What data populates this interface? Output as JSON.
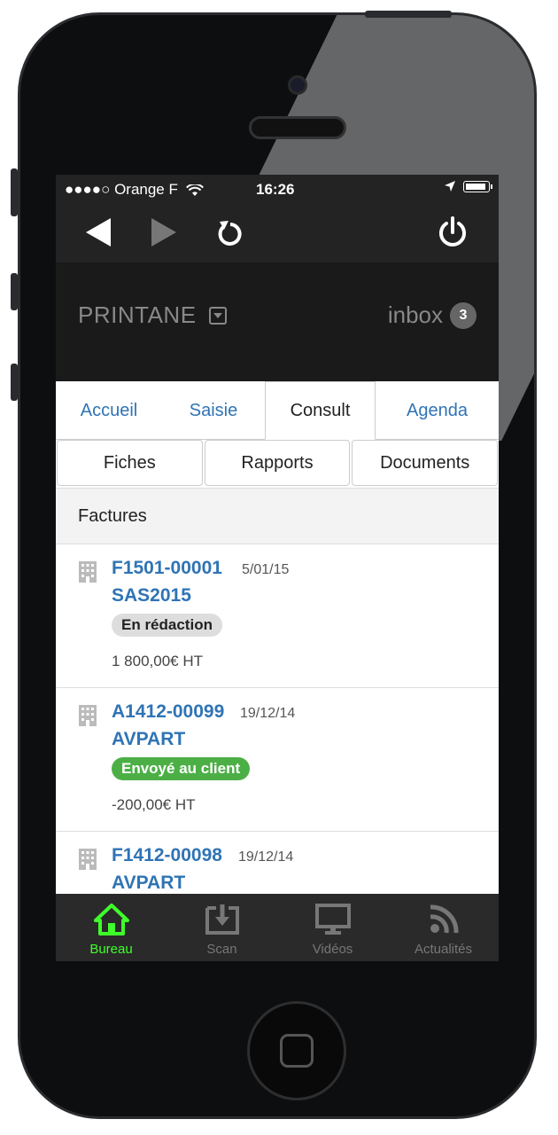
{
  "status_bar": {
    "carrier": "●●●●○ Orange F",
    "time": "16:26"
  },
  "header": {
    "brand": "PRINTANE",
    "inbox_label": "inbox",
    "inbox_count": "3"
  },
  "tabs": [
    {
      "label": "Accueil",
      "active": false
    },
    {
      "label": "Saisie",
      "active": false
    },
    {
      "label": "Consult",
      "active": true
    },
    {
      "label": "Agenda",
      "active": false
    }
  ],
  "segments": [
    {
      "label": "Fiches"
    },
    {
      "label": "Rapports"
    },
    {
      "label": "Documents"
    }
  ],
  "section_title": "Factures",
  "invoices": [
    {
      "ref": "F1501-00001",
      "date": "5/01/15",
      "client": "SAS2015",
      "status": "En rédaction",
      "status_color": "#dddddd",
      "amount": "1 800,00€ HT"
    },
    {
      "ref": "A1412-00099",
      "date": "19/12/14",
      "client": "AVPART",
      "status": "Envoyé au client",
      "status_color": "#4caf46",
      "amount": "-200,00€ HT"
    },
    {
      "ref": "F1412-00098",
      "date": "19/12/14",
      "client": "AVPART"
    }
  ],
  "bottom_tabs": [
    {
      "label": "Bureau",
      "icon": "home-icon",
      "active": true
    },
    {
      "label": "Scan",
      "icon": "download-icon",
      "active": false
    },
    {
      "label": "Vidéos",
      "icon": "monitor-icon",
      "active": false
    },
    {
      "label": "Actualités",
      "icon": "rss-icon",
      "active": false
    }
  ],
  "colors": {
    "accent": "#2f74b5",
    "active_tab": "#3fff2a",
    "status_green": "#4caf46"
  }
}
